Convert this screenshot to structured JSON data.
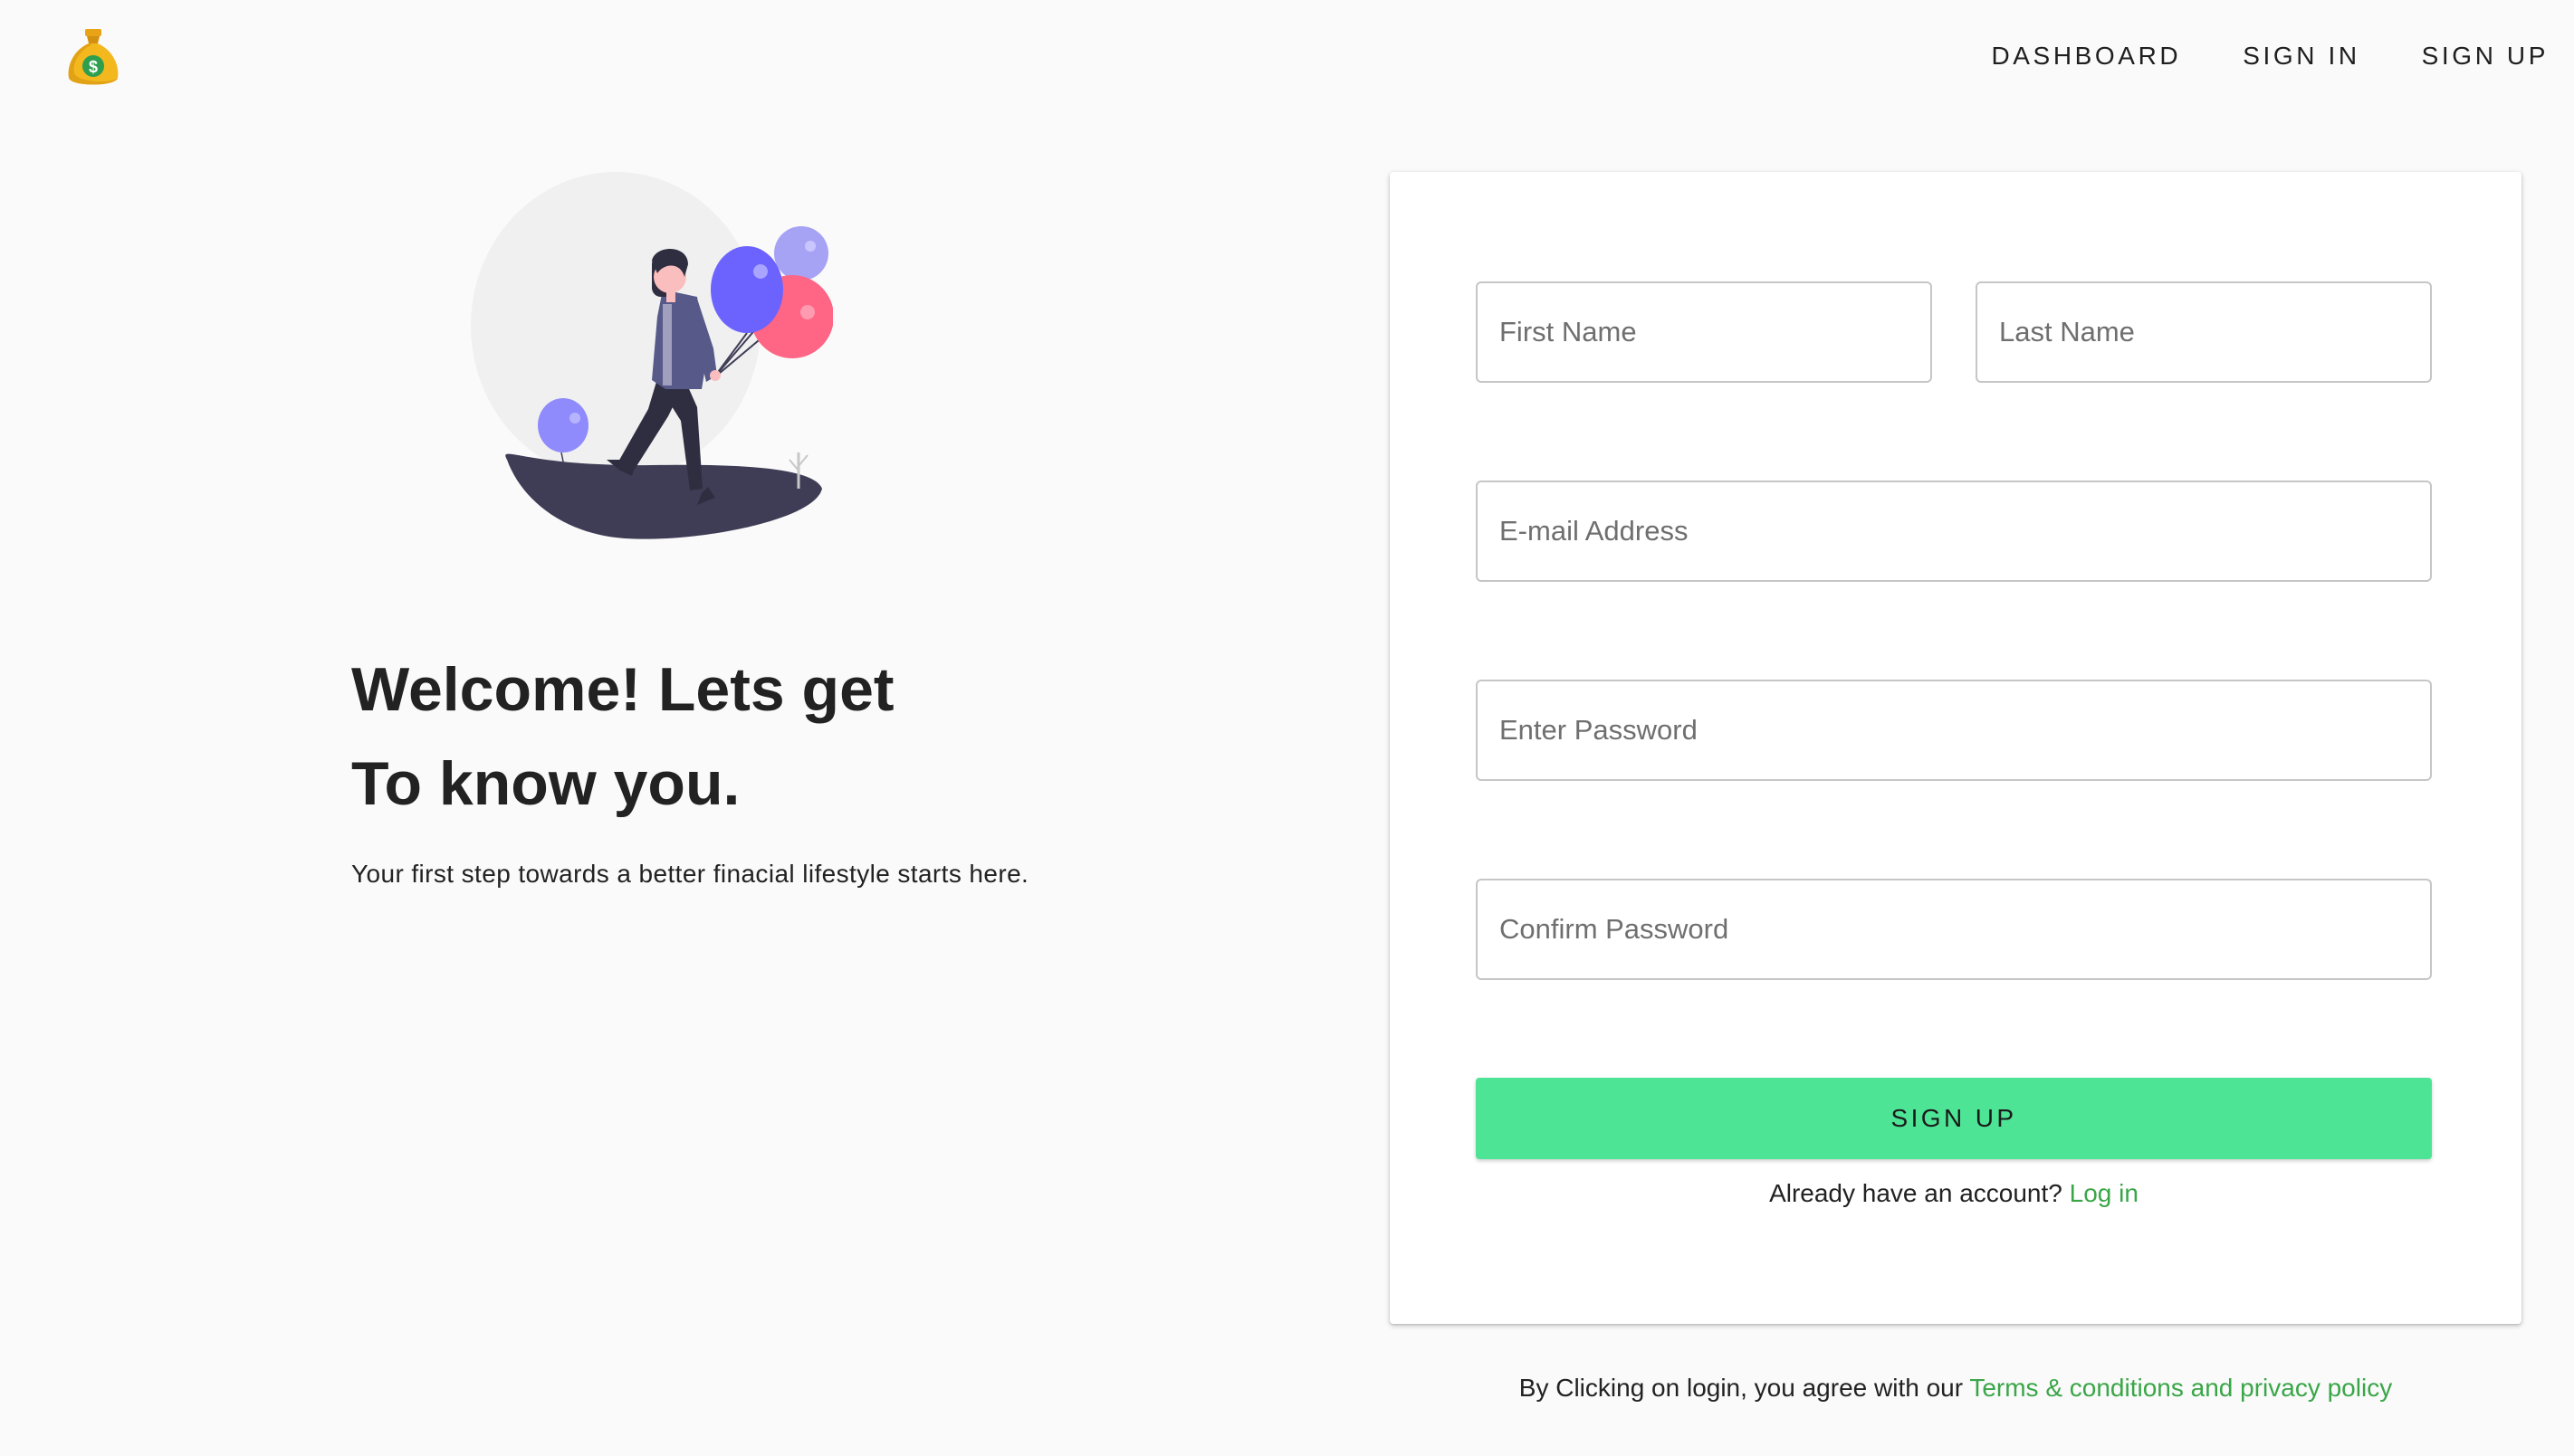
{
  "nav": {
    "dashboard": "DASHBOARD",
    "sign_in": "SIGN IN",
    "sign_up": "SIGN UP"
  },
  "hero": {
    "title_line1": "Welcome! Lets get",
    "title_line2": "To know you.",
    "tagline": "Your first step towards a better finacial lifestyle starts here."
  },
  "form": {
    "first_name_placeholder": "First Name",
    "last_name_placeholder": "Last Name",
    "email_placeholder": "E-mail Address",
    "password_placeholder": "Enter Password",
    "confirm_placeholder": "Confirm Password",
    "submit_label": "SIGN UP",
    "already_text": "Already have an account?",
    "login_link": "Log in"
  },
  "footer": {
    "terms_text": "By Clicking on login, you agree with our",
    "terms_link": "Terms & conditions and privacy policy"
  },
  "icons": {
    "logo": "money-bag-icon",
    "illustration": "woman-with-balloons-illustration"
  },
  "colors": {
    "accent": "#4de595",
    "link": "#3aa648",
    "background": "#fafafa",
    "balloon_purple": "#6c63ff",
    "balloon_pink": "#ff6584"
  }
}
